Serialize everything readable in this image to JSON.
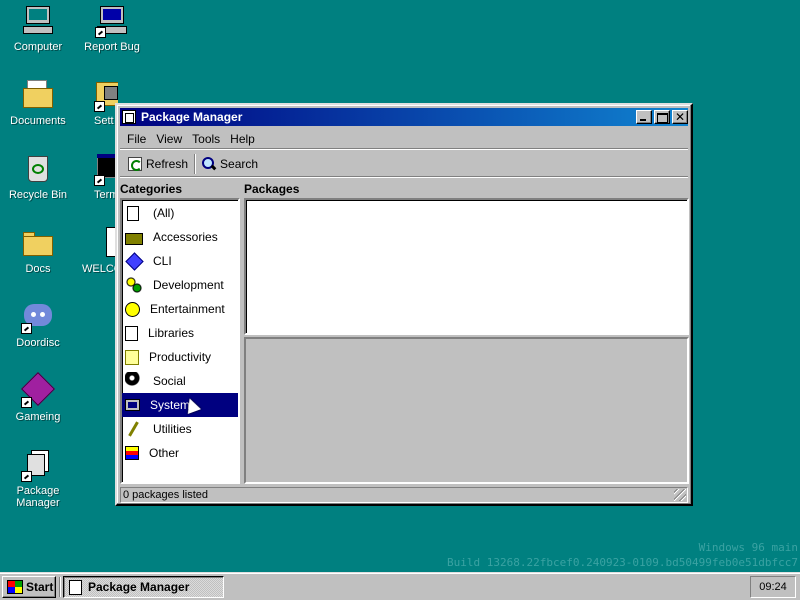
{
  "desktop": {
    "icons": [
      {
        "label": "Computer",
        "icon": "computer-icon"
      },
      {
        "label": "Report Bug",
        "icon": "report-bug-icon"
      },
      {
        "label": "Documents",
        "icon": "documents-folder-icon"
      },
      {
        "label": "Sett",
        "icon": "settings-icon"
      },
      {
        "label": "Recycle Bin",
        "icon": "recycle-bin-icon"
      },
      {
        "label": "Term",
        "icon": "terminal-icon"
      },
      {
        "label": "Docs",
        "icon": "folder-icon"
      },
      {
        "label": "WELCO",
        "icon": "welcome-document-icon"
      },
      {
        "label": "Doordisc",
        "icon": "doordisc-icon"
      },
      {
        "label": "Gameing",
        "icon": "gameing-icon"
      },
      {
        "label": "Package\nManager",
        "icon": "package-manager-icon"
      }
    ],
    "watermark": {
      "line1": "Windows 96 main",
      "line2": "Build 13268.22fbcef0.240923-0109.bd50499feb0e51dbfcc7"
    }
  },
  "window": {
    "title": "Package Manager",
    "menu": [
      "File",
      "View",
      "Tools",
      "Help"
    ],
    "toolbar": {
      "refresh": "Refresh",
      "search": "Search"
    },
    "categories_header": "Categories",
    "packages_header": "Packages",
    "categories": [
      {
        "label": "(All)",
        "icon": "all-icon"
      },
      {
        "label": "Accessories",
        "icon": "accessories-icon"
      },
      {
        "label": "CLI",
        "icon": "cli-icon"
      },
      {
        "label": "Development",
        "icon": "development-icon"
      },
      {
        "label": "Entertainment",
        "icon": "entertainment-icon"
      },
      {
        "label": "Libraries",
        "icon": "libraries-icon"
      },
      {
        "label": "Productivity",
        "icon": "productivity-icon"
      },
      {
        "label": "Social",
        "icon": "social-icon"
      },
      {
        "label": "System",
        "icon": "system-icon",
        "selected": true
      },
      {
        "label": "Utilities",
        "icon": "utilities-icon"
      },
      {
        "label": "Other",
        "icon": "other-icon"
      }
    ],
    "status": "0 packages listed"
  },
  "taskbar": {
    "start_label": "Start",
    "task_label": "Package Manager",
    "clock": "09:24"
  },
  "colors": {
    "desktop": "#008080",
    "titlebar_start": "#000080",
    "titlebar_end": "#1084d0",
    "selection": "#000080",
    "face": "#c0c0c0"
  }
}
